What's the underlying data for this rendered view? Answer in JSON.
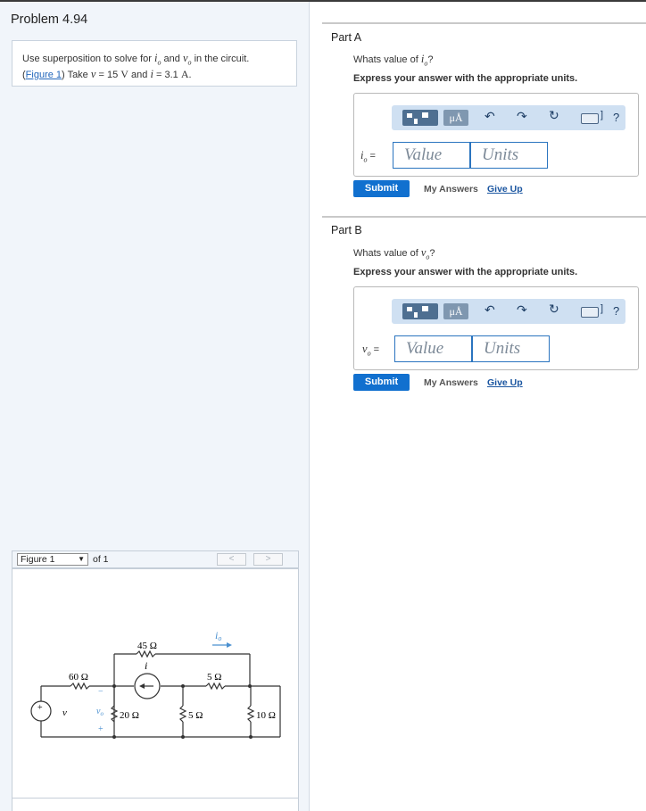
{
  "problem": {
    "title": "Problem 4.94",
    "text_pre": "Use superposition to solve for",
    "var_io": "i",
    "sub_o": "o",
    "text_and": "and",
    "var_vo": "v",
    "text_circuit": "in the circuit.",
    "figure_link": "Figure 1",
    "text_take": "Take",
    "var_v": "v",
    "text_eq15": "= 15",
    "unit_V": "V",
    "text_and2": "and",
    "var_i": "i",
    "text_eq31": "= 3.1",
    "unit_A": "A"
  },
  "figure": {
    "select_value": "Figure 1",
    "of_text": "of 1",
    "prev": "<",
    "next": ">",
    "circuit": {
      "r45": "45 Ω",
      "r60": "60 Ω",
      "r5a": "5 Ω",
      "r20": "20 Ω",
      "r5b": "5 Ω",
      "r10": "10 Ω",
      "i_label": "i",
      "io_label": "i",
      "io_sub": "o",
      "v_label": "v",
      "vo_label": "v",
      "vo_sub": "o",
      "plus": "+",
      "minus": "−",
      "src_plus": "+"
    }
  },
  "partA": {
    "title": "Part A",
    "question_pre": "Whats value of",
    "var": "i",
    "sub": "o",
    "question_post": "?",
    "instruction": "Express your answer with the appropriate units.",
    "mu_label": "μÅ",
    "help": "?",
    "value_label_var": "i",
    "value_label_sub": "o",
    "value_label_eq": " =",
    "value_placeholder": "Value",
    "units_placeholder": "Units",
    "submit": "Submit",
    "my_answers": "My Answers",
    "give_up": "Give Up"
  },
  "partB": {
    "title": "Part B",
    "question_pre": "Whats value of",
    "var": "v",
    "sub": "o",
    "question_post": "?",
    "instruction": "Express your answer with the appropriate units.",
    "mu_label": "μÅ",
    "help": "?",
    "value_label_var": "v",
    "value_label_sub": "o",
    "value_label_eq": " =",
    "value_placeholder": "Value",
    "units_placeholder": "Units",
    "submit": "Submit",
    "my_answers": "My Answers",
    "give_up": "Give Up"
  },
  "colors": {
    "accent": "#1170cf",
    "toolbar": "#cfe0f2",
    "link": "#2266bb"
  }
}
